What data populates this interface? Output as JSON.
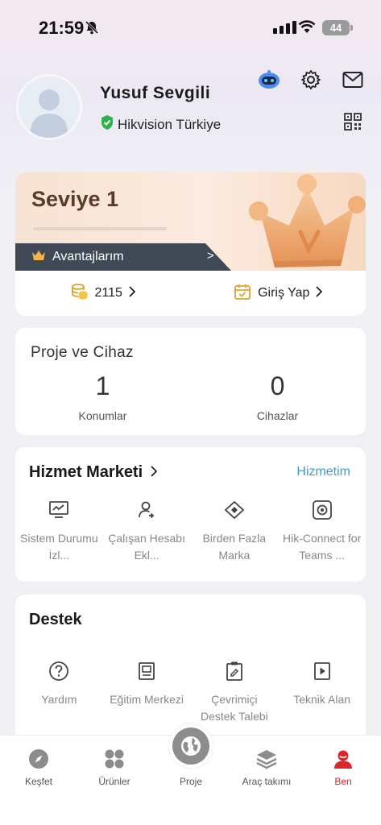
{
  "status_bar": {
    "time": "21:59",
    "battery": "44"
  },
  "profile": {
    "name": "Yusuf Sevgili",
    "organization": "Hikvision Türkiye"
  },
  "level_card": {
    "title": "Seviye 1",
    "progress": 0,
    "benefits_label": "Avantajlarım",
    "benefits_arrow": ">",
    "points": "2115",
    "checkin_label": "Giriş Yap"
  },
  "project_card": {
    "title": "Proje ve Cihaz",
    "stats": [
      {
        "value": "1",
        "label": "Konumlar"
      },
      {
        "value": "0",
        "label": "Cihazlar"
      }
    ]
  },
  "service_market": {
    "title": "Hizmet Marketi",
    "link": "Hizmetim",
    "items": [
      {
        "icon": "monitor-chart-icon",
        "label": "Sistem Durumu İzl..."
      },
      {
        "icon": "user-add-icon",
        "label": "Çalışan Hesabı Ekl..."
      },
      {
        "icon": "diamond-arrows-icon",
        "label": "Birden Fazla Marka"
      },
      {
        "icon": "target-square-icon",
        "label": "Hik-Connect for Teams ..."
      }
    ]
  },
  "support": {
    "title": "Destek",
    "items": [
      {
        "icon": "question-circle-icon",
        "label": "Yardım"
      },
      {
        "icon": "book-icon",
        "label": "Eğitim Merkezi"
      },
      {
        "icon": "clipboard-edit-icon",
        "label": "Çevrimiçi Destek Talebi"
      },
      {
        "icon": "play-doc-icon",
        "label": "Teknik Alan"
      }
    ]
  },
  "tab_bar": {
    "items": [
      {
        "icon": "compass-icon",
        "label": "Keşfet"
      },
      {
        "icon": "grid-icon",
        "label": "Ürünler"
      },
      {
        "icon": "globe-icon",
        "label": "Proje"
      },
      {
        "icon": "layers-icon",
        "label": "Araç takımı"
      },
      {
        "icon": "person-icon",
        "label": "Ben"
      }
    ],
    "active": "Ben"
  },
  "colors": {
    "accent_blue": "#3d9bd6",
    "active_red": "#d9262b",
    "benefits_bg": "#404a57"
  }
}
